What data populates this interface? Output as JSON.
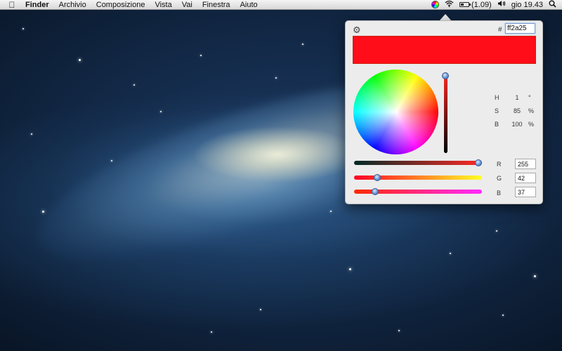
{
  "menubar": {
    "apple": "",
    "items": [
      "Finder",
      "Archivio",
      "Composizione",
      "Vista",
      "Vai",
      "Finestra",
      "Aiuto"
    ],
    "status": {
      "color_picker_icon": "color-wheel-icon",
      "wifi_icon": "wifi-icon",
      "battery": "(1.09)",
      "volume_icon": "volume-icon",
      "clock": "gio 19.43",
      "search_icon": "search-icon"
    }
  },
  "picker": {
    "gear_icon": "gear-icon",
    "hash": "#",
    "hex_value": "ff2a25",
    "swatch_color": "#ff0d18",
    "brightness_level": 1.0,
    "hsb": {
      "h": {
        "label": "H",
        "value": "1",
        "unit": "°"
      },
      "s": {
        "label": "S",
        "value": "85",
        "unit": "%"
      },
      "b": {
        "label": "B",
        "value": "100",
        "unit": "%"
      }
    },
    "rgb": {
      "r": {
        "label": "R",
        "value": "255"
      },
      "g": {
        "label": "G",
        "value": "42"
      },
      "b": {
        "label": "B",
        "value": "37"
      }
    }
  }
}
